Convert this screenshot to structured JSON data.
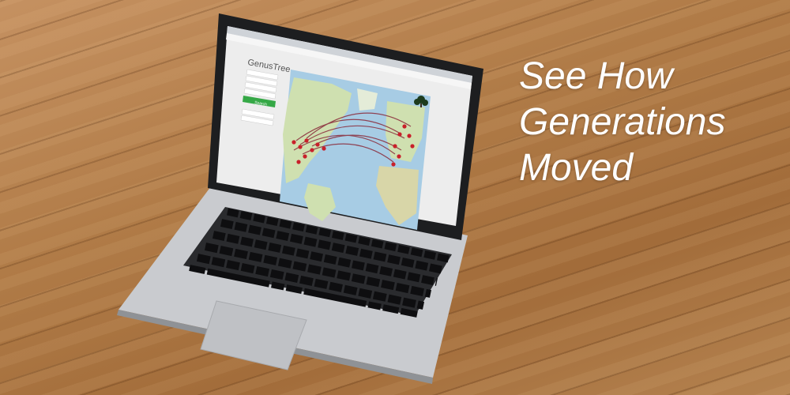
{
  "headline": {
    "line1": "See How",
    "line2": "Generations",
    "line3": "Moved"
  },
  "screen": {
    "app_title": "GenusTree",
    "search_button_label": "Search"
  },
  "colors": {
    "text": "#ffffff",
    "floor": "#b07b47",
    "laptop_body": "#c9cbcf",
    "search_button": "#35a846",
    "ocean": "#a7cce4",
    "land": "#cfe0b0",
    "marker": "#c8202a",
    "migration_line": "#8a2a3a"
  },
  "icons": [
    "map-marker-icon",
    "tree-logo-icon"
  ]
}
